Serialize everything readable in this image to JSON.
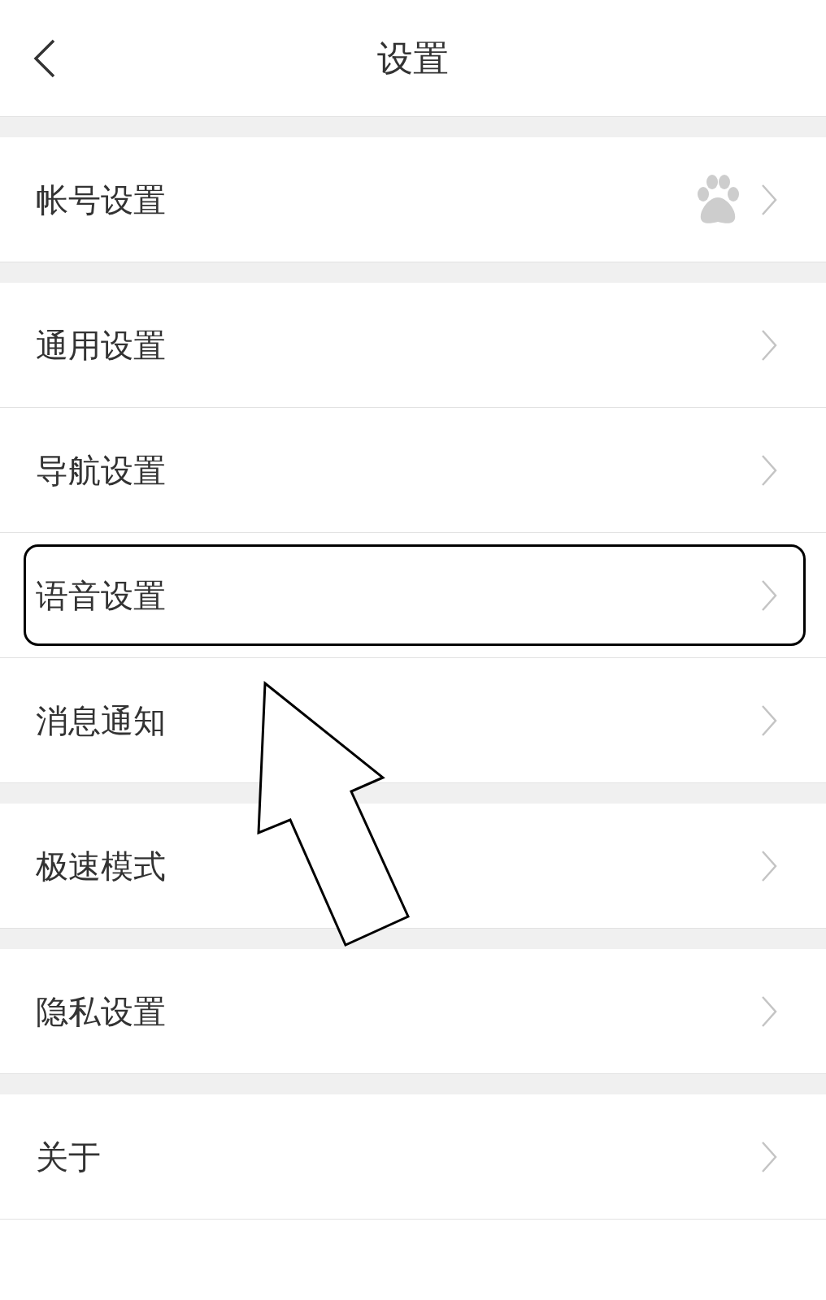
{
  "header": {
    "title": "设置"
  },
  "sections": [
    {
      "rows": [
        {
          "label": "帐号设置",
          "kind": "account",
          "highlighted": false
        }
      ]
    },
    {
      "rows": [
        {
          "label": "通用设置",
          "kind": "plain",
          "highlighted": false
        },
        {
          "label": "导航设置",
          "kind": "plain",
          "highlighted": false
        },
        {
          "label": "语音设置",
          "kind": "plain",
          "highlighted": true
        },
        {
          "label": "消息通知",
          "kind": "plain",
          "highlighted": false
        }
      ]
    },
    {
      "rows": [
        {
          "label": "极速模式",
          "kind": "plain",
          "highlighted": false
        }
      ]
    },
    {
      "rows": [
        {
          "label": "隐私设置",
          "kind": "plain",
          "highlighted": false
        }
      ]
    },
    {
      "rows": [
        {
          "label": "关于",
          "kind": "plain",
          "highlighted": false
        }
      ]
    }
  ]
}
